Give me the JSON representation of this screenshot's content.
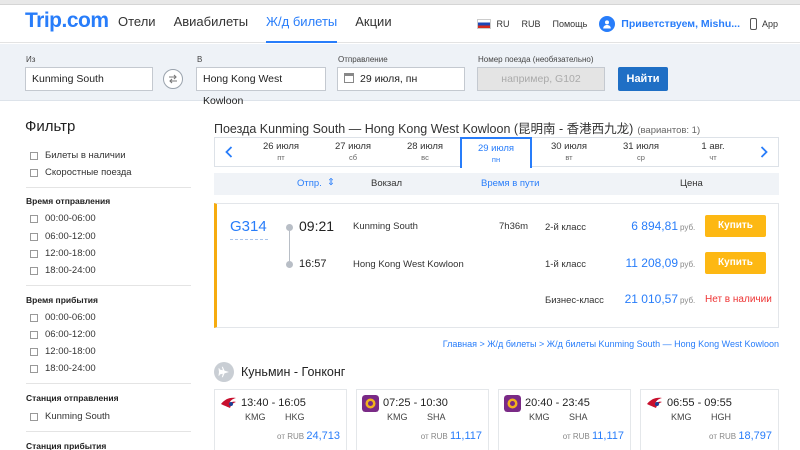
{
  "header": {
    "logo": "Trip.com",
    "nav": [
      "Отели",
      "Авиабилеты",
      "Ж/д билеты",
      "Акции"
    ],
    "lang": "RU",
    "currency": "RUB",
    "help": "Помощь",
    "user": "Приветствуем, Mishu...",
    "app": "App"
  },
  "search": {
    "from_label": "Из",
    "from_value": "Kunming South",
    "to_label": "В",
    "to_value": "Hong Kong West Kowloon",
    "date_label": "Отправление",
    "date_value": "29 июля, пн",
    "train_label": "Номер поезда (необязательно)",
    "train_placeholder": "например, G102",
    "find_button": "Найти"
  },
  "sidebar": {
    "title": "Фильтр",
    "quick": [
      "Билеты в наличии",
      "Скоростные поезда"
    ],
    "departure_title": "Время отправления",
    "departure_slots": [
      "00:00-06:00",
      "06:00-12:00",
      "12:00-18:00",
      "18:00-24:00"
    ],
    "arrival_title": "Время прибытия",
    "arrival_slots": [
      "00:00-06:00",
      "06:00-12:00",
      "12:00-18:00",
      "18:00-24:00"
    ],
    "dep_station_title": "Станция отправления",
    "dep_station": "Kunming South",
    "arr_station_title": "Станция прибытия"
  },
  "main": {
    "title": "Поезда Kunming South — Hong Kong West Kowloon (昆明南 - 香港西九龙)",
    "variants": "(вариантов: 1)",
    "dates": [
      {
        "d": "26 июля",
        "w": "пт"
      },
      {
        "d": "27 июля",
        "w": "сб"
      },
      {
        "d": "28 июля",
        "w": "вс"
      },
      {
        "d": "29 июля",
        "w": "пн"
      },
      {
        "d": "30 июля",
        "w": "вт"
      },
      {
        "d": "31 июля",
        "w": "ср"
      },
      {
        "d": "1 авг.",
        "w": "чт"
      }
    ],
    "active_date_index": 3,
    "columns": {
      "departure": "Отпр.",
      "station": "Вокзал",
      "duration": "Время в пути",
      "price": "Цена"
    }
  },
  "train": {
    "number": "G314",
    "dep_time": "09:21",
    "arr_time": "16:57",
    "dep_station": "Kunming South",
    "arr_station": "Hong Kong West Kowloon",
    "duration": "7h36m",
    "classes": [
      {
        "name": "2-й класс",
        "price": "6 894,81",
        "currency": "руб.",
        "action": "Купить"
      },
      {
        "name": "1-й класс",
        "price": "11 208,09",
        "currency": "руб.",
        "action": "Купить"
      },
      {
        "name": "Бизнес-класс",
        "price": "21 010,57",
        "currency": "руб.",
        "status": "Нет в наличии"
      }
    ]
  },
  "breadcrumb": "Главная > Ж/д билеты > Ж/д билеты Kunming South — Hong Kong West Kowloon",
  "flights_section": {
    "title": "Куньмин - Гонконг",
    "flights": [
      {
        "times": "13:40 - 16:05",
        "from": "KMG",
        "to": "HKG",
        "prefix": "от RUB",
        "price": "24,713",
        "logo_color": "#c8102e"
      },
      {
        "times": "07:25 - 10:30",
        "from": "KMG",
        "to": "SHA",
        "prefix": "от RUB",
        "price": "11,117",
        "logo_color": "#7a2a86"
      },
      {
        "times": "20:40 - 23:45",
        "from": "KMG",
        "to": "SHA",
        "prefix": "от RUB",
        "price": "11,117",
        "logo_color": "#7a2a86"
      },
      {
        "times": "06:55 - 09:55",
        "from": "KMG",
        "to": "HGH",
        "prefix": "от RUB",
        "price": "18,797",
        "logo_color": "#c8102e"
      }
    ]
  },
  "colors": {
    "brand": "#287dfa",
    "accent": "#fdb813",
    "unavailable": "#e33333"
  }
}
